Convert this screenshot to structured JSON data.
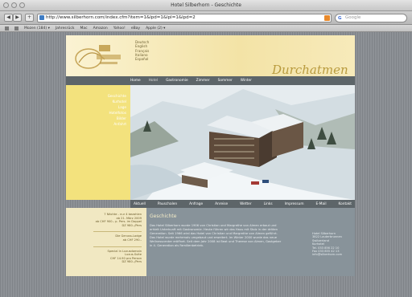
{
  "window": {
    "title": "Hotel Silberhorn - Geschichte"
  },
  "toolbar": {
    "url": "http://www.silberhorn.com/index.cfm?item=1&lpd=1&lpl=1&lpd=2",
    "search_placeholder": "Google"
  },
  "bookmarks": [
    "Mozen (184) ▾",
    "Jahresrück",
    "Mac",
    "Amazon",
    "Yahoo!",
    "eBay",
    "Apple (2) ▾"
  ],
  "site": {
    "languages": [
      "Deutsch",
      "English",
      "Français",
      "Italiano",
      "Español"
    ],
    "header_text": "Durchatmen",
    "nav": [
      "Home",
      "Hotel",
      "Gastronomie",
      "Zimmer",
      "Sommer",
      "Winter"
    ],
    "submenu": [
      "Geschichte",
      "Kurhotel",
      "Lage",
      "Hotelfotos",
      "Bilder",
      "Anfahrt"
    ],
    "nav2": [
      "Aktuell",
      "Pauschalen",
      "Anfrage",
      "Anreise",
      "Wetter",
      "Links",
      "Impressum",
      "E-Mail",
      "Kontakt"
    ],
    "news": [
      "7 Nächte - nur 4 bezahlen\nab 21. März 2009\nab CHF 900.- p. Pers. im Doppel\nDZ 980.-/Pers",
      "Die Genuss-Lodge\nab CHF 290.-",
      "Special in Luxusdomain\nLuxus-Suite\nCHF 14.90 pro Person\nDZ 980.-/Pers"
    ],
    "content_title": "Geschichte",
    "content_body": "Das Hotel Silberhorn wurde 1906 von Christian und Margrethe von Almen erbaut und erhielt Unterkunft mit Gastronomie. Heute führen wir das Haus mit Stolz in der dritten Generation. Seit 1966 wird das Hotel von Christian und Margrethe von Almen geführt. Das Hotel wurde mehrmals umgebaut und erweitert. Im Winter 2000 wurde das neue Wellnesscenter eröffnet. Seit dem Jahr 2008 ist Beat und Therese von Almen, Gastgeber in 4. Generation als Familienbetrieb.",
    "address": [
      "Hotel Silberhorn",
      "3822 Lauterbrunnen",
      "Switzerland",
      "Kurhotel",
      "Tel. 033 856 22 10",
      "Fax 033 855 42 13",
      "info@silberhorn.com"
    ]
  }
}
